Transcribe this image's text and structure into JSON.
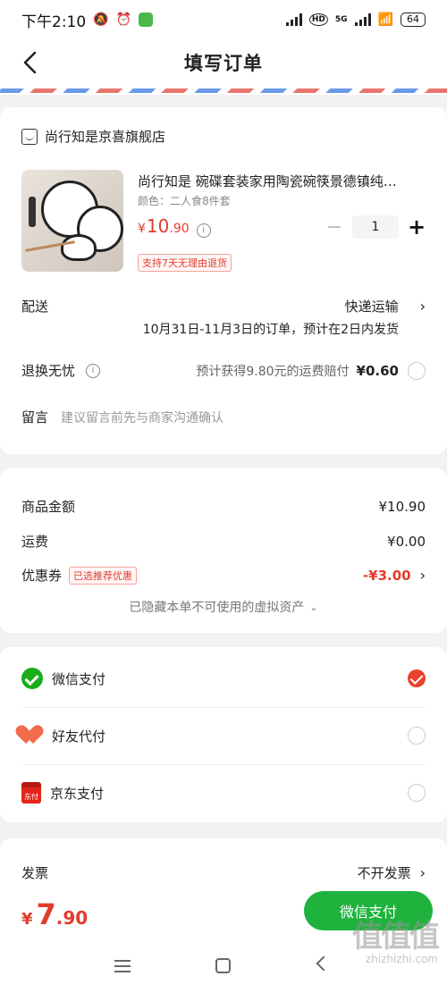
{
  "status_bar": {
    "time": "下午2:10",
    "network": "5G",
    "battery": "64"
  },
  "header": {
    "title": "填写订单"
  },
  "shop": {
    "name": "尚行知是京喜旗舰店",
    "product": {
      "title": "尚行知是 碗碟套装家用陶瓷碗筷景德镇纯…",
      "spec": "颜色：二人食8件套",
      "price_currency": "¥",
      "price_int": "10",
      "price_dec": ".90",
      "return_policy": "支持7天无理由退货",
      "qty": "1",
      "minus": "−",
      "plus": "+"
    },
    "delivery": {
      "label": "配送",
      "method": "快递运输",
      "note": "10月31日-11月3日的订单，预计在2日内发货"
    },
    "return_insurance": {
      "label": "退换无忧",
      "desc": "预计获得9.80元的运费赔付",
      "price": "¥0.60"
    },
    "message": {
      "label": "留言",
      "placeholder": "建议留言前先与商家沟通确认"
    }
  },
  "summary": {
    "goods_label": "商品金额",
    "goods_value": "¥10.90",
    "shipping_label": "运费",
    "shipping_value": "¥0.00",
    "coupon_label": "优惠券",
    "coupon_badge": "已选推荐优惠",
    "coupon_value": "-¥3.00",
    "hidden_note": "已隐藏本单不可使用的虚拟资产"
  },
  "payment": {
    "options": [
      {
        "name": "微信支付",
        "selected": true,
        "icon": "wechat-pay-icon"
      },
      {
        "name": "好友代付",
        "selected": false,
        "icon": "friend-pay-icon"
      },
      {
        "name": "京东支付",
        "selected": false,
        "icon": "jd-pay-icon"
      }
    ],
    "jd_icon_text": "东付"
  },
  "invoice": {
    "label": "发票",
    "value": "不开发票"
  },
  "footer": {
    "total_currency": "¥",
    "total_int": "7",
    "total_dec": ".90",
    "pay_button": "微信支付"
  },
  "watermark": {
    "big": "值值值",
    "small": "zhizhizhi.com"
  },
  "colors": {
    "accent_red": "#e33c2d",
    "wechat_green": "#1fb33e"
  }
}
